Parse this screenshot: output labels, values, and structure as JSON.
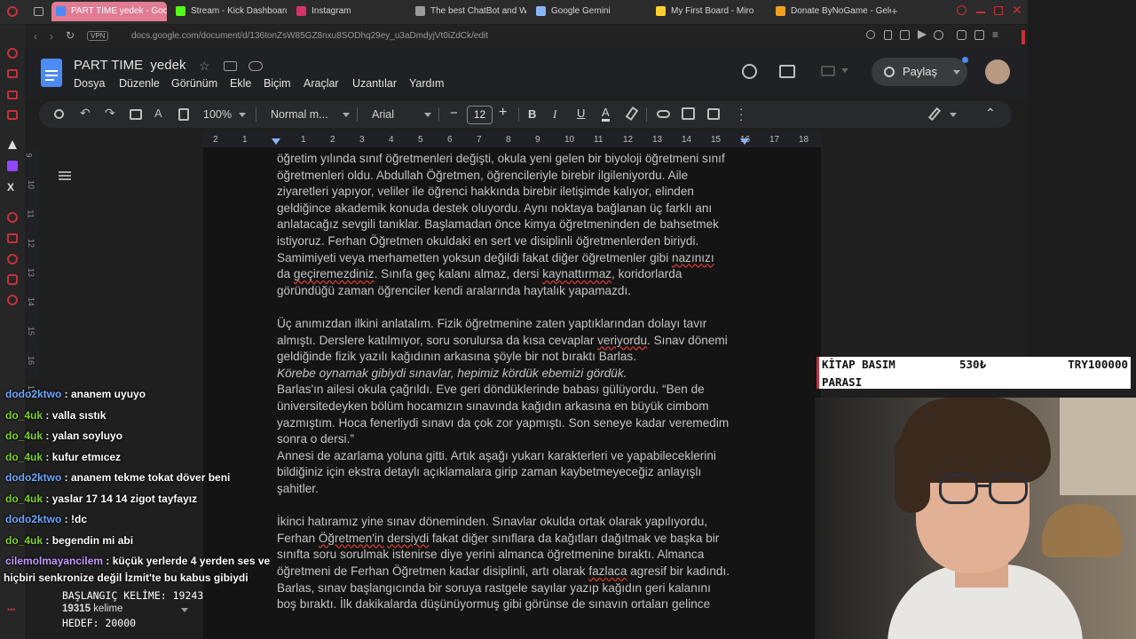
{
  "browser": {
    "tabs": [
      {
        "label": "PART TIME yedek - Goog",
        "color": "#4c8bf5",
        "active": true
      },
      {
        "label": "Stream - Kick Dashboard",
        "color": "#53fc18",
        "active": false
      },
      {
        "label": "Instagram",
        "color": "#d6336c",
        "active": false
      },
      {
        "label": "The best ChatBot and W",
        "color": "#9a9a9a",
        "active": false
      },
      {
        "label": "Google Gemini",
        "color": "#8ab4f8",
        "active": false
      },
      {
        "label": "My First Board - Miro",
        "color": "#ffd02f",
        "active": false
      },
      {
        "label": "Donate ByNoGame - Gele",
        "color": "#f0a020",
        "active": false
      }
    ],
    "vpn_label": "VPN",
    "url": "docs.google.com/document/d/136tonZsW85GZ8nxu8SODhq29ey_u3aDmdyjVt0iZdCk/edit"
  },
  "docs": {
    "title": "PART TIME  yedek",
    "menu": [
      "Dosya",
      "Düzenle",
      "Görünüm",
      "Ekle",
      "Biçim",
      "Araçlar",
      "Uzantılar",
      "Yardım"
    ],
    "share_label": "Paylaş",
    "zoom": "100%",
    "style": "Normal m...",
    "font": "Arial",
    "font_size": "12",
    "ruler_ticks": [
      "2",
      "1",
      "1",
      "2",
      "3",
      "4",
      "5",
      "6",
      "7",
      "8",
      "9",
      "10",
      "11",
      "12",
      "13",
      "14",
      "15",
      "16",
      "17",
      "18"
    ],
    "vruler_ticks": [
      "9",
      "10",
      "11",
      "12",
      "13",
      "14",
      "15",
      "16",
      "17"
    ],
    "accent": "#8ab4f8"
  },
  "document": {
    "p1": [
      "öğretim yılında sınıf öğretmenleri değişti, okula yeni gelen bir biyoloji öğretmeni sınıf",
      "öğretmenleri oldu. Abdullah Öğretmen, öğrencileriyle birebir ilgileniyordu. Aile",
      "ziyaretleri yapıyor, veliler ile öğrenci hakkında birebir iletişimde kalıyor, elinden",
      "geldiğince akademik konuda destek oluyordu. Aynı noktaya bağlanan üç farklı anı",
      "anlatacağız sevgili tanıklar. Başlamadan önce kimya öğretmeninden de bahsetmek",
      "istiyoruz. Ferhan Öğretmen okuldaki en sert ve disiplinli öğretmenlerden biriydi.",
      "Samimiyeti veya merhametten yoksun değildi fakat diğer öğretmenler gibi nazınızı",
      "da geçiremezdiniz. Sınıfa geç kalanı almaz, dersi kaynattırmaz, koridorlarda",
      "göründüğü zaman öğrenciler kendi aralarında haytalık yapamazdı."
    ],
    "p2": [
      "Üç anımızdan ilkini anlatalım. Fizik öğretmenine zaten yaptıklarından dolayı tavır",
      "almıştı. Derslere katılmıyor, soru sorulursa da kısa cevaplar veriyordu. Sınav dönemi",
      "geldiğinde fizik yazılı kağıdının arkasına şöyle bir not bıraktı Barlas."
    ],
    "italic": "Körebe oynamak gibiydi sınavlar, hepimiz kördük ebemizi gördük.",
    "p3": [
      "Barlas'ın ailesi okula çağrıldı. Eve geri döndüklerinde babası gülüyordu. “Ben de",
      "üniversitedeyken bölüm hocamızın sınavında kağıdın arkasına en büyük cimbom",
      "yazmıştım. Hoca fenerliydi sınavı da çok zor yapmıştı. Son seneye kadar veremedim",
      "sonra o dersi.”",
      "Annesi de azarlama yoluna gitti. Artık aşağı yukarı karakterleri ve yapabileceklerini",
      "bildiğiniz için ekstra detaylı açıklamalara girip zaman kaybetmeyeceğiz anlayışlı",
      "şahitler."
    ],
    "p4": [
      "İkinci hatıramız yine sınav döneminden. Sınavlar okulda ortak olarak yapılıyordu,",
      "Ferhan Öğretmen'in dersiydi fakat diğer sınıflara da kağıtları dağıtmak ve başka bir",
      "sınıfta soru sorulmak istenirse diye yerini almanca öğretmenine bıraktı. Almanca",
      "öğretmeni de Ferhan Öğretmen kadar disiplinli, artı olarak fazlaca agresif bir kadındı.",
      "Barlas, sınav başlangıcında bir soruya rastgele sayılar yazıp kağıdın geri kalanını",
      "boş bıraktı. İlk dakikalarda düşünüyormuş gibi görünse de sınavın ortaları gelince"
    ]
  },
  "chat": [
    {
      "user": "dodo2ktwo",
      "color": "#6fa8ff",
      "msg": "ananem uyuyo"
    },
    {
      "user": "do_4uk",
      "color": "#7ed321",
      "msg": "valla sıstık"
    },
    {
      "user": "do_4uk",
      "color": "#7ed321",
      "msg": "yalan soyluyo"
    },
    {
      "user": "do_4uk",
      "color": "#7ed321",
      "msg": "kufur etmıcez"
    },
    {
      "user": "dodo2ktwo",
      "color": "#6fa8ff",
      "msg": "ananem tekme tokat döver beni"
    },
    {
      "user": "do_4uk",
      "color": "#7ed321",
      "msg": "yaslar 17 14 14 zigot tayfayız"
    },
    {
      "user": "dodo2ktwo",
      "color": "#6fa8ff",
      "msg": "!dc"
    },
    {
      "user": "do_4uk",
      "color": "#7ed321",
      "msg": "begendin mi abi"
    },
    {
      "user": "cilemolmayancilem",
      "color": "#c39bff",
      "msg": "küçük yerlerde 4 yerden ses ve",
      "cont": "hiçbiri senkronize değil İzmit'te bu kabus gibiydi"
    }
  ],
  "counter": {
    "start_label": "BAŞLANGIÇ KELİME: 19243",
    "words": "19315",
    "words_label": "kelime",
    "goal_label": "HEDEF: 20000"
  },
  "overlay": {
    "line1_left": "KİTAP BASIM",
    "line1_mid": "530₺",
    "line1_right": "TRY100000",
    "line2": "PARASI"
  }
}
